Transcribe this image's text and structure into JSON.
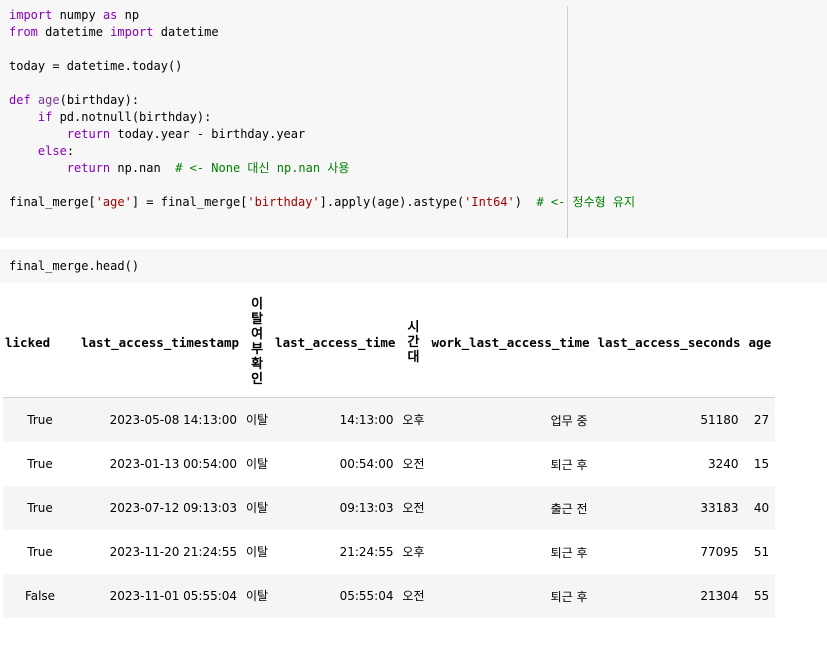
{
  "cell1": {
    "line1": {
      "a": "import",
      "b": " numpy ",
      "c": "as",
      "d": " np"
    },
    "line2": {
      "a": "from",
      "b": " datetime ",
      "c": "import",
      "d": " datetime"
    },
    "line4": {
      "a": "today = datetime.today()"
    },
    "line6": {
      "a": "def",
      "b": " ",
      "c": "age",
      "d": "(birthday):"
    },
    "line7": {
      "a": "    ",
      "b": "if",
      "c": " pd.notnull(birthday):"
    },
    "line8": {
      "a": "        ",
      "b": "return",
      "c": " today.year - birthday.year"
    },
    "line9": {
      "a": "    ",
      "b": "else",
      "c": ":"
    },
    "line10": {
      "a": "        ",
      "b": "return",
      "c": " np.nan  ",
      "d": "# <- None 대신 np.nan 사용"
    },
    "line12": {
      "a": "final_merge[",
      "b": "'age'",
      "c": "] = final_merge[",
      "d": "'birthday'",
      "e": "].apply(age).astype(",
      "f": "'Int64'",
      "g": ")  ",
      "h": "# <- 정수형 유지"
    }
  },
  "cell2": {
    "code": "final_merge.head()"
  },
  "table": {
    "headers": [
      "licked",
      "last_access_timestamp",
      "이탈여부확인",
      "last_access_time",
      "시간대",
      "work_last_access_time",
      "last_access_seconds",
      "age"
    ],
    "rows": [
      [
        "True",
        "2023-05-08 14:13:00",
        "이탈",
        "14:13:00",
        "오후",
        "업무 중",
        "51180",
        "27"
      ],
      [
        "True",
        "2023-01-13 00:54:00",
        "이탈",
        "00:54:00",
        "오전",
        "퇴근 후",
        "3240",
        "15"
      ],
      [
        "True",
        "2023-07-12 09:13:03",
        "이탈",
        "09:13:03",
        "오전",
        "출근 전",
        "33183",
        "40"
      ],
      [
        "True",
        "2023-11-20 21:24:55",
        "이탈",
        "21:24:55",
        "오후",
        "퇴근 후",
        "77095",
        "51"
      ],
      [
        "False",
        "2023-11-01 05:55:04",
        "이탈",
        "05:55:04",
        "오전",
        "퇴근 후",
        "21304",
        "55"
      ]
    ]
  }
}
